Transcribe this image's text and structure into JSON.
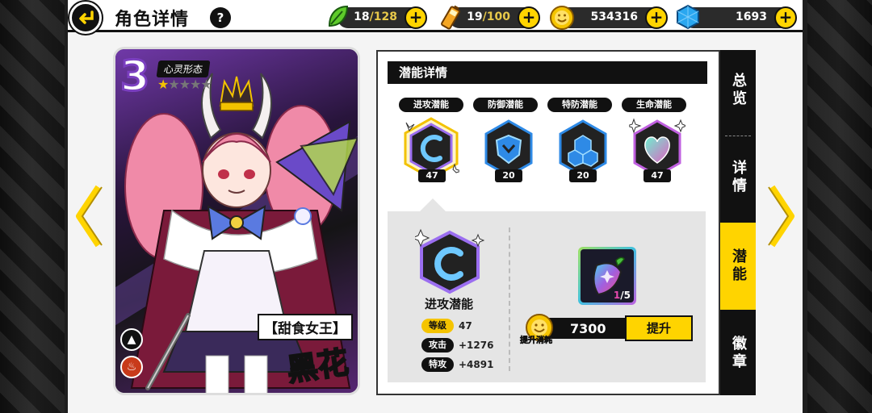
{
  "header": {
    "title": "角色详情",
    "help_label": "?"
  },
  "resources": {
    "stamina": {
      "current": "18",
      "max": "/128",
      "icon": "leaf-icon",
      "color": "#5ecb2a"
    },
    "energy": {
      "current": "19",
      "max": "/100",
      "icon": "battery-icon",
      "color": "#f5a623"
    },
    "gold": {
      "value": "534316",
      "icon": "coin-icon",
      "color": "#f5c400"
    },
    "gems": {
      "value": "1693",
      "icon": "gem-icon",
      "color": "#2aa7f0"
    },
    "plus_label": "+"
  },
  "card": {
    "rank": "3",
    "form_label": "心灵形态",
    "stars_filled": 1,
    "stars_total": 5,
    "subtitle": "【甜食女王】",
    "name": "黑花",
    "element_icons": [
      "triangle-icon",
      "flame-icon"
    ]
  },
  "potential": {
    "header": "潜能详情",
    "items": [
      {
        "label": "进攻潜能",
        "level": "47",
        "color": "#9b6ef0",
        "icon": "attack-swirl-icon"
      },
      {
        "label": "防御潜能",
        "level": "20",
        "color": "#2e8ae6",
        "icon": "shield-icon"
      },
      {
        "label": "特防潜能",
        "level": "20",
        "color": "#2e8ae6",
        "icon": "hexagon-cluster-icon"
      },
      {
        "label": "生命潜能",
        "level": "47",
        "color": "#c060e0",
        "icon": "heart-icon"
      }
    ],
    "selected": {
      "name": "进攻潜能",
      "stats": [
        {
          "tag": "等级",
          "value": "47"
        },
        {
          "tag": "攻击",
          "value": "+1276"
        },
        {
          "tag": "特攻",
          "value": "+4891"
        }
      ]
    },
    "material": {
      "have": "1",
      "need": "/5",
      "icon": "pepper-icon"
    },
    "cost": {
      "value": "7300",
      "label": "提升消耗"
    },
    "upgrade_label": "提升"
  },
  "tabs": [
    {
      "label": "总览",
      "active": false
    },
    {
      "label": "详情",
      "active": false
    },
    {
      "label": "潜能",
      "active": true
    },
    {
      "label": "徽章",
      "active": false
    }
  ]
}
